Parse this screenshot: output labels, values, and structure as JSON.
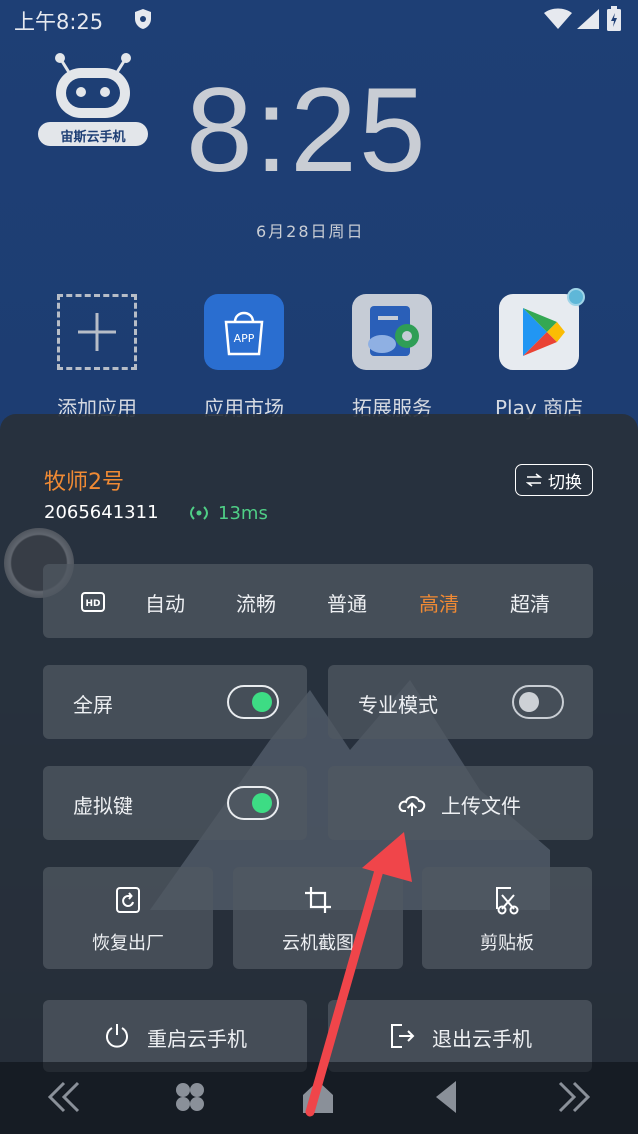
{
  "status_bar": {
    "time": "上午8:25"
  },
  "home": {
    "logo_text": "宙斯云手机",
    "clock": "8:25",
    "date": "6月28日周日",
    "apps": [
      {
        "label": "添加应用",
        "icon": "add-app-icon"
      },
      {
        "label": "应用市场",
        "icon": "app-market-icon",
        "icon_text": "APP"
      },
      {
        "label": "拓展服务",
        "icon": "extension-service-icon"
      },
      {
        "label": "Play 商店",
        "icon": "play-store-icon"
      }
    ]
  },
  "panel": {
    "device_name": "牧师2号",
    "device_id": "2065641311",
    "latency": "13ms",
    "switch_label": "切换",
    "quality": {
      "options": [
        "自动",
        "流畅",
        "普通",
        "高清",
        "超清"
      ],
      "selected": "高清"
    },
    "toggles": [
      {
        "label": "全屏",
        "on": true
      },
      {
        "label": "专业模式",
        "on": false
      },
      {
        "label": "虚拟键",
        "on": true
      }
    ],
    "upload_label": "上传文件",
    "tools": [
      {
        "label": "恢复出厂",
        "icon": "factory-reset-icon"
      },
      {
        "label": "云机截图",
        "icon": "crop-screenshot-icon"
      },
      {
        "label": "剪贴板",
        "icon": "clipboard-scissors-icon"
      }
    ],
    "restart_label": "重启云手机",
    "exit_label": "退出云手机"
  },
  "colors": {
    "accent_orange": "#f08a34",
    "latency_green": "#4fcf86",
    "toggle_green": "#3ddc84",
    "arrow_red": "#f0454a"
  }
}
